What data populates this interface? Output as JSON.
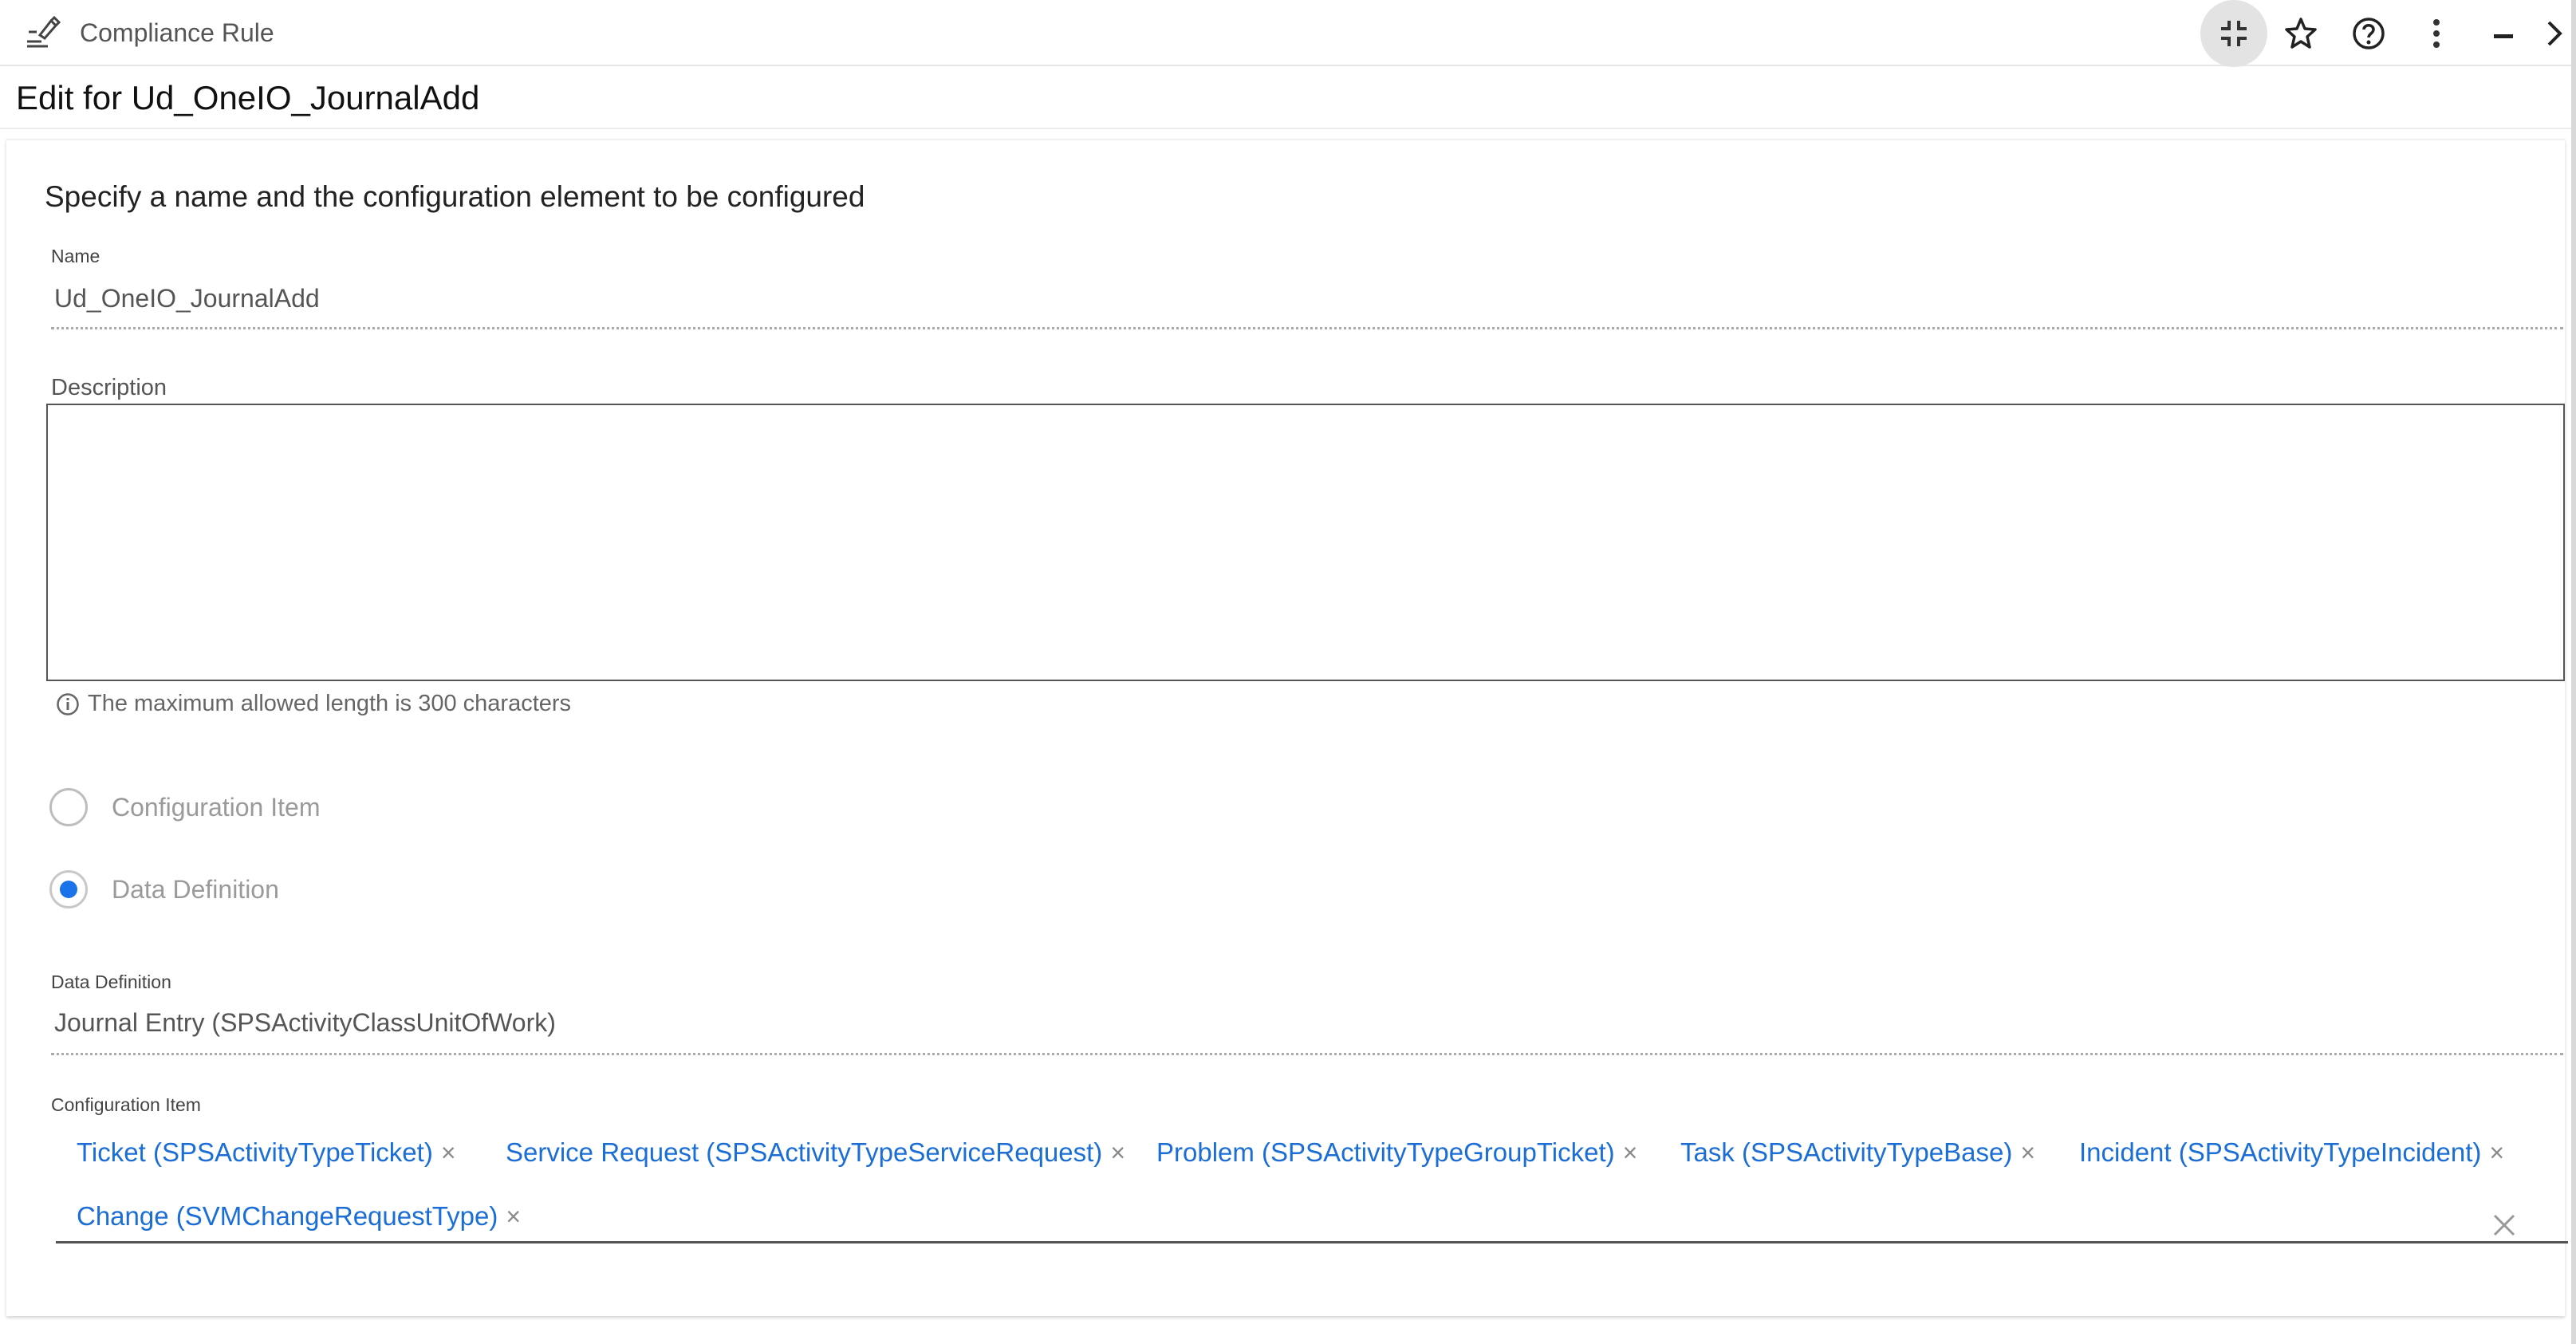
{
  "window": {
    "app_title": "Compliance Rule",
    "app_icon": "compliance-rule-icon",
    "buttons": [
      {
        "name": "exit-fullscreen-icon",
        "active": true
      },
      {
        "name": "star-icon",
        "active": false
      },
      {
        "name": "help-icon",
        "active": false
      },
      {
        "name": "more-vert-icon",
        "active": false
      },
      {
        "name": "minimize-icon",
        "active": false
      },
      {
        "name": "chevron-right-icon",
        "active": false
      }
    ]
  },
  "header": {
    "edit_title": "Edit for Ud_OneIO_JournalAdd"
  },
  "form": {
    "section_title": "Specify a name and the configuration element to be configured",
    "name_label": "Name",
    "name_value": "Ud_OneIO_JournalAdd",
    "description_label": "Description",
    "description_value": "",
    "description_hint": "The maximum allowed length is 300 characters",
    "radio_options": [
      {
        "label": "Configuration Item",
        "checked": false
      },
      {
        "label": "Data Definition",
        "checked": true
      }
    ],
    "data_definition_label": "Data Definition",
    "data_definition_value": "Journal Entry (SPSActivityClassUnitOfWork)",
    "config_item_label": "Configuration Item",
    "config_items": [
      "Ticket (SPSActivityTypeTicket)",
      "Service Request (SPSActivityTypeServiceRequest)",
      "Problem (SPSActivityTypeGroupTicket)",
      "Task (SPSActivityTypeBase)",
      "Incident (SPSActivityTypeIncident)",
      "Change (SVMChangeRequestType)"
    ],
    "chip_remove_glyph": "×"
  },
  "colors": {
    "accent": "#1a73e8",
    "chip_text": "#1b6ed6"
  }
}
